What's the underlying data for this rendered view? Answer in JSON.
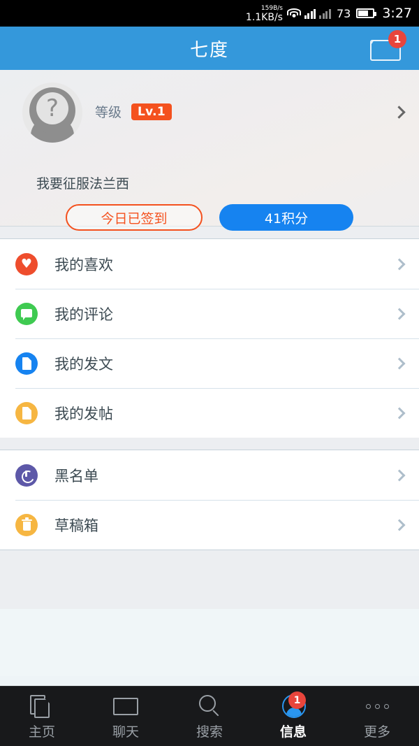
{
  "status_bar": {
    "net_up": "159B/s",
    "net_down": "1.1KB/s",
    "battery_percent": "73",
    "time": "3:27"
  },
  "header": {
    "title": "七度",
    "mail_badge": "1"
  },
  "profile": {
    "level_label": "等级",
    "level_badge": "Lv.1",
    "username": "我要征服法兰西",
    "avatar_glyph": "?",
    "sign_in_button": "今日已签到",
    "points_button": "41积分",
    "accent_orange": "#f4511e",
    "accent_blue": "#1683f0"
  },
  "menu_groups": [
    {
      "items": [
        {
          "label": "我的喜欢",
          "icon": "heart-icon",
          "color": "#ee4d2d"
        },
        {
          "label": "我的评论",
          "icon": "comment-icon",
          "color": "#3fca51"
        },
        {
          "label": "我的发文",
          "icon": "document-blue-icon",
          "color": "#1683f0"
        },
        {
          "label": "我的发帖",
          "icon": "document-yellow-icon",
          "color": "#f6b642"
        }
      ]
    },
    {
      "items": [
        {
          "label": "黑名单",
          "icon": "block-icon",
          "color": "#5d58a8"
        },
        {
          "label": "草稿箱",
          "icon": "trash-icon",
          "color": "#f6b642"
        }
      ]
    }
  ],
  "tabbar": {
    "tabs": [
      {
        "label": "主页",
        "icon": "documents-icon",
        "active": false,
        "badge": ""
      },
      {
        "label": "聊天",
        "icon": "envelope-icon",
        "active": false,
        "badge": ""
      },
      {
        "label": "搜索",
        "icon": "search-icon",
        "active": false,
        "badge": ""
      },
      {
        "label": "信息",
        "icon": "person-icon",
        "active": true,
        "badge": "1"
      },
      {
        "label": "更多",
        "icon": "more-dots-icon",
        "active": false,
        "badge": ""
      }
    ]
  }
}
